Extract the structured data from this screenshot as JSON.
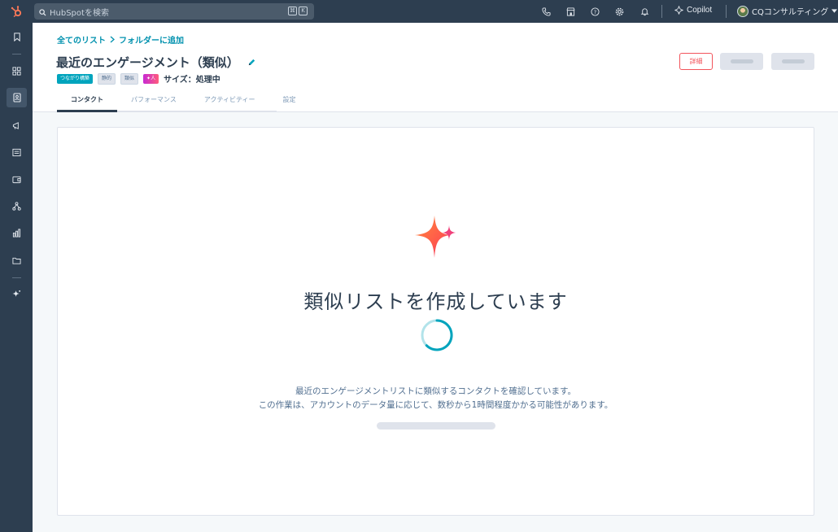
{
  "search": {
    "placeholder": "HubSpotを検索",
    "shortcut_keys": [
      "⌘",
      "K"
    ]
  },
  "topnav": {
    "icons": [
      "phone-icon",
      "marketplace-icon",
      "help-icon",
      "settings-icon",
      "notifications-icon"
    ],
    "copilot_label": "Copilot",
    "account_name": "CQコンサルティング"
  },
  "sidebar": {
    "items": [
      "bookmark-icon",
      "workspaces-icon",
      "contacts-icon",
      "marketing-icon",
      "content-icon",
      "commerce-icon",
      "automation-icon",
      "reporting-icon",
      "library-icon",
      "ai-sparkle-icon"
    ],
    "active_index": 2
  },
  "breadcrumb": {
    "parent": "全てのリスト",
    "action": "フォルダーに追加"
  },
  "list": {
    "title": "最近のエンゲージメント（類似）",
    "tags": [
      "つながり構築",
      "静的",
      "類似",
      "✦人"
    ],
    "size_label": "サイズ：処理中"
  },
  "actions": {
    "detail_label": "詳細"
  },
  "tabs": [
    {
      "label": "コンタクト",
      "active": true
    },
    {
      "label": "パフォーマンス",
      "active": false
    },
    {
      "label": "アクティビティー",
      "active": false
    },
    {
      "label": "設定",
      "active": false
    }
  ],
  "status": {
    "heading": "類似リストを作成しています",
    "line1": "最近のエンゲージメントリストに類似するコンタクトを確認しています。",
    "line2": "この作業は、アカウントのデータ量に応じて、数秒から1時間程度かかる可能性があります。"
  },
  "colors": {
    "nav": "#2d3e50",
    "accent": "#0091ae",
    "detail_button": "#f2545b",
    "spinner": "#00a4bd"
  }
}
